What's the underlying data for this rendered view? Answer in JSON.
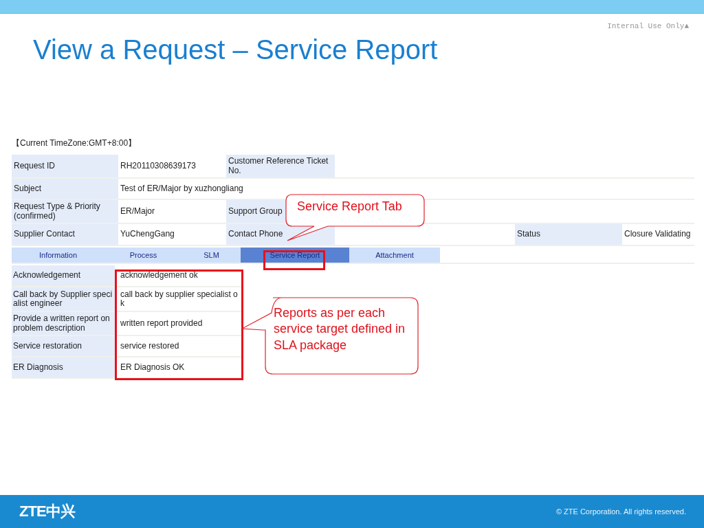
{
  "slide": {
    "classification": "Internal Use Only▲",
    "title": "View a Request – Service Report",
    "footer": {
      "logo": "ZTE中兴",
      "copyright": "© ZTE Corporation. All rights reserved."
    }
  },
  "screen": {
    "timezone": "【Current TimeZone:GMT+8:00】",
    "fields": [
      [
        {
          "kind": "label",
          "text": "Request ID"
        },
        {
          "kind": "value",
          "text": "RH20110308639173"
        },
        {
          "kind": "label",
          "text": "Customer Reference Ticket No."
        },
        {
          "kind": "value"
        }
      ],
      [
        {
          "kind": "label",
          "text": "Subject"
        },
        {
          "kind": "value",
          "text": "Test of ER/Major by xuzhongliang"
        }
      ],
      [
        {
          "kind": "label",
          "text": "Request Type & Priority (confirmed)"
        },
        {
          "kind": "value",
          "text": "ER/Major"
        },
        {
          "kind": "label",
          "text": "Support Group"
        },
        {
          "kind": "value"
        }
      ],
      [
        {
          "kind": "label",
          "text": "Supplier Contact"
        },
        {
          "kind": "value",
          "text": "YuChengGang"
        },
        {
          "kind": "label",
          "text": "Contact Phone"
        },
        {
          "kind": "value"
        },
        {
          "kind": "label",
          "text": "Status"
        },
        {
          "kind": "value",
          "text": "Closure Validating"
        }
      ]
    ],
    "tabs": [
      {
        "label": "Information",
        "selected": false
      },
      {
        "label": "Process",
        "selected": false
      },
      {
        "label": "SLM",
        "selected": false
      },
      {
        "label": "Service Report",
        "selected": true
      },
      {
        "label": "Attachment",
        "selected": false
      }
    ],
    "reports": [
      {
        "label": "Acknowledgement",
        "value": "acknowledgement ok"
      },
      {
        "label": "Call back by Supplier specialist engineer",
        "value": "call back by supplier specialist ok"
      },
      {
        "label": "Provide a written report on problem description",
        "value": "written report provided"
      },
      {
        "label": "Service restoration",
        "value": "service restored"
      },
      {
        "label": "ER Diagnosis",
        "value": "ER Diagnosis OK"
      }
    ]
  },
  "callouts": [
    {
      "kind": "tab",
      "text": "Service Report Tab"
    },
    {
      "kind": "reports",
      "text": "Reports as per each service target defined in SLA package"
    }
  ]
}
